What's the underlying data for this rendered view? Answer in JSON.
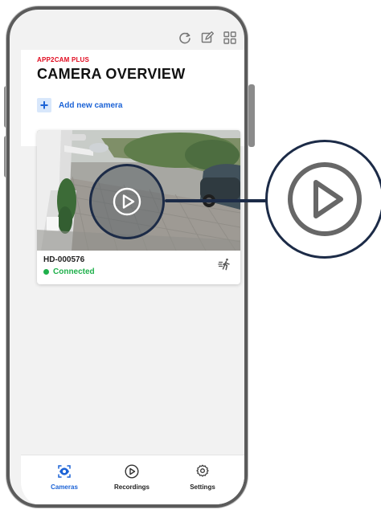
{
  "header": {
    "app_name": "APP2CAM PLUS",
    "title": "CAMERA OVERVIEW"
  },
  "toolbar": {
    "icons": [
      "refresh-icon",
      "edit-icon",
      "grid-view-icon"
    ]
  },
  "actions": {
    "add_camera_icon": "plus-icon",
    "add_camera_label": "Add new camera"
  },
  "camera_card": {
    "name": "HD-000576",
    "status": "Connected",
    "status_color": "#1fb04b",
    "preview_icon": "play-icon",
    "motion_icon": "motion-detection-icon"
  },
  "bottom_nav": {
    "items": [
      {
        "label": "Cameras",
        "icon": "camera-eye-icon",
        "active": true
      },
      {
        "label": "Recordings",
        "icon": "play-circle-icon",
        "active": false
      },
      {
        "label": "Settings",
        "icon": "gear-icon",
        "active": false
      }
    ]
  },
  "colors": {
    "brand_red": "#e10a1f",
    "accent_blue": "#1c63d6",
    "connected_green": "#1fb04b",
    "callout_navy": "#1c2b47"
  }
}
